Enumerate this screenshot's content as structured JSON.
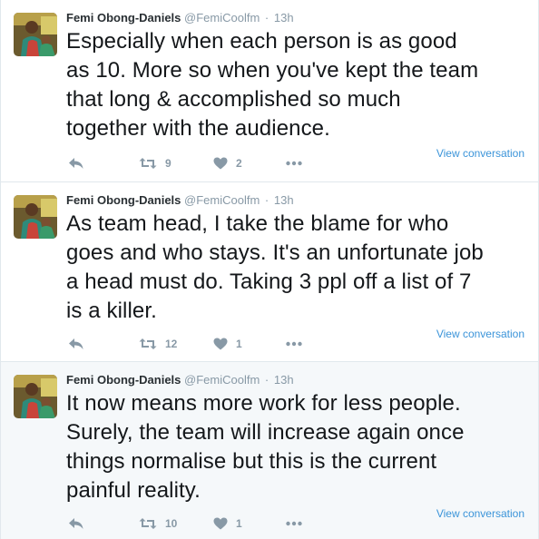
{
  "tweets": [
    {
      "fullname": "Femi Obong-Daniels",
      "username": "@FemiCoolfm",
      "separator": "·",
      "time": "13h",
      "text": "Especially when each person is as good\nas 10. More so when you've kept the team\nthat long & accomplished so much\ntogether with the audience.",
      "retweets": "9",
      "likes": "2",
      "view_conversation": "View conversation"
    },
    {
      "fullname": "Femi Obong-Daniels",
      "username": "@FemiCoolfm",
      "separator": "·",
      "time": "13h",
      "text": "As team head, I take the blame for who\ngoes and who stays. It's an unfortunate job\na head must do. Taking 3 ppl off a list of 7\nis a killer.",
      "retweets": "12",
      "likes": "1",
      "view_conversation": "View conversation"
    },
    {
      "fullname": "Femi Obong-Daniels",
      "username": "@FemiCoolfm",
      "separator": "·",
      "time": "13h",
      "text": "It now means more work for less people.\nSurely, the team will increase again once\nthings normalise but this is the current\npainful reality.",
      "retweets": "10",
      "likes": "1",
      "view_conversation": "View conversation"
    }
  ],
  "icons": {
    "reply": "reply-icon",
    "retweet": "retweet-icon",
    "like": "heart-icon",
    "more": "more-dots-icon"
  },
  "colors": {
    "text": "#14171a",
    "muted": "#8899a6",
    "link": "#3b94d9",
    "border": "#e1e8ed",
    "highlight_bg": "#f5f8fa"
  }
}
